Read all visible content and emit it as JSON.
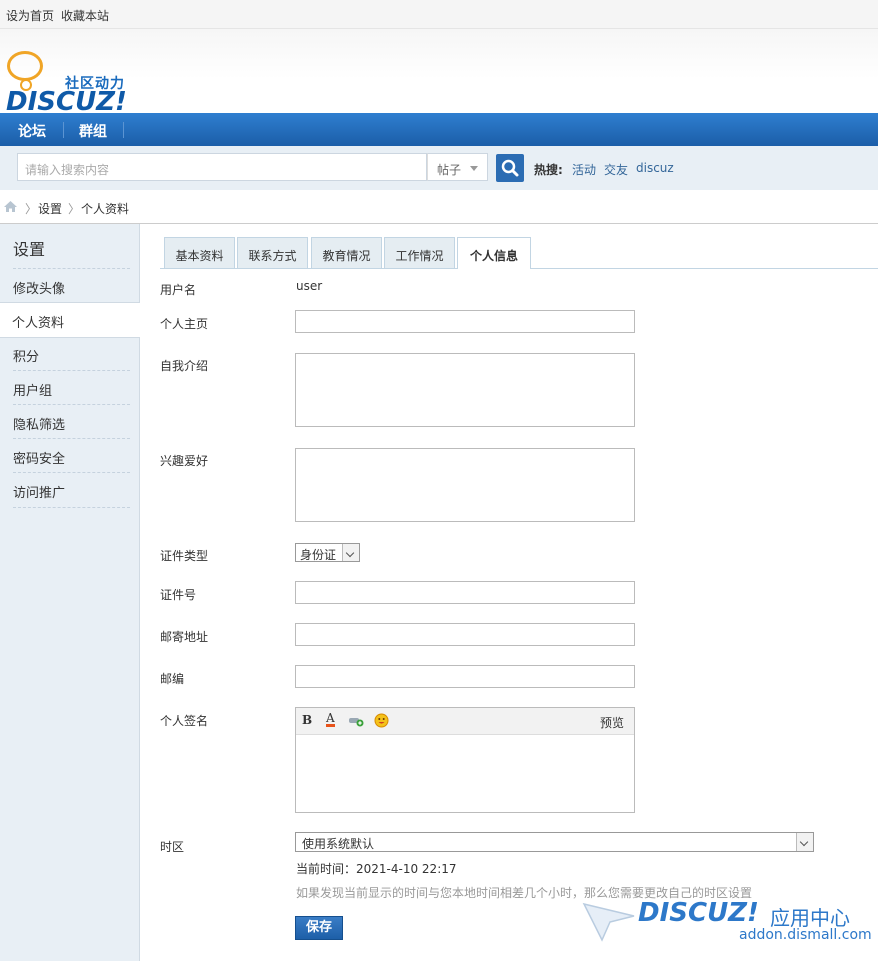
{
  "topbar": {
    "set_home": "设为首页",
    "bookmark": "收藏本站"
  },
  "logo": {
    "sub": "社区动力",
    "main": "DISCUZ!"
  },
  "nav": {
    "items": [
      "论坛",
      "群组"
    ]
  },
  "search": {
    "placeholder": "请输入搜索内容",
    "type": "帖子",
    "hot_label": "热搜:",
    "hot_links": [
      "活动",
      "交友",
      "discuz"
    ]
  },
  "breadcrumb": [
    "设置",
    "个人资料"
  ],
  "sidebar": {
    "title": "设置",
    "items": [
      "修改头像",
      "个人资料",
      "积分",
      "用户组",
      "隐私筛选",
      "密码安全",
      "访问推广"
    ],
    "active_index": 1
  },
  "tabs": [
    "基本资料",
    "联系方式",
    "教育情况",
    "工作情况",
    "个人信息"
  ],
  "active_tab": 4,
  "form": {
    "username_label": "用户名",
    "username_value": "user",
    "homepage_label": "个人主页",
    "bio_label": "自我介绍",
    "interests_label": "兴趣爱好",
    "idtype_label": "证件类型",
    "idtype_value": "身份证",
    "idnumber_label": "证件号",
    "address_label": "邮寄地址",
    "zipcode_label": "邮编",
    "signature_label": "个人签名",
    "signature_preview": "预览",
    "timezone_label": "时区",
    "timezone_value": "使用系统默认",
    "current_time": "当前时间：2021-4-10 22:17",
    "timezone_hint": "如果发现当前显示的时间与您本地时间相差几个小时，那么您需要更改自己的时区设置",
    "save_label": "保存"
  },
  "watermark": {
    "brand": "DISCUZ!",
    "cn": "应用中心",
    "url": "addon.dismall.com"
  },
  "colors": {
    "nav": "#1b5ea8",
    "link": "#336699",
    "sidebar_bg": "#e8eff5"
  }
}
